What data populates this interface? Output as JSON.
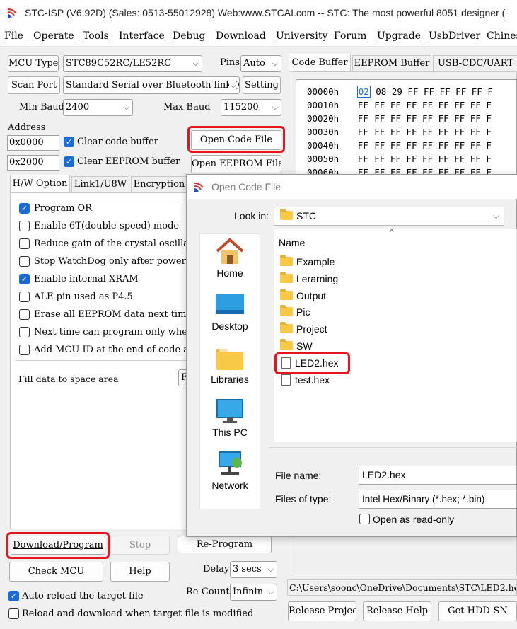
{
  "window": {
    "title": "STC-ISP (V6.92D) (Sales: 0513-55012928) Web:www.STCAI.com  -- STC: The most powerful 8051 designer (",
    "menu": [
      "File",
      "Operate",
      "Tools",
      "Interface",
      "Debug",
      "Download",
      "University",
      "Forum",
      "Upgrade",
      "UsbDriver",
      "Chines"
    ]
  },
  "mcu": {
    "type_label": "MCU Type",
    "type_value": "STC89C52RC/LE52RC",
    "pins_label": "Pins",
    "pins_value": "Auto",
    "scan_port_label": "Scan Port",
    "port_value": "Standard Serial over Bluetooth link (C",
    "setting_label": "Setting",
    "min_baud_label": "Min Baud",
    "min_baud_value": "2400",
    "max_baud_label": "Max Baud",
    "max_baud_value": "115200",
    "address_label": "Address",
    "address1": "0x0000",
    "address2": "0x2000",
    "clear_code_label": "Clear code buffer",
    "clear_eeprom_label": "Clear EEPROM buffer",
    "open_code_file": "Open Code File",
    "open_eeprom_file": "Open EEPROM File"
  },
  "hw_tabs": [
    "H/W Option",
    "Link1/U8W",
    "Encryption"
  ],
  "options": [
    {
      "label": "Program OR",
      "checked": true
    },
    {
      "label": "Enable 6T(double-speed) mode",
      "checked": false
    },
    {
      "label": "Reduce gain of the crystal oscillator",
      "checked": false
    },
    {
      "label": "Stop WatchDog only after power-do",
      "checked": false
    },
    {
      "label": "Enable internal XRAM",
      "checked": true
    },
    {
      "label": "ALE pin used as P4.5",
      "checked": false
    },
    {
      "label": "Erase all EEPROM data next time pr",
      "checked": false
    },
    {
      "label": "Next time can program only when P1",
      "checked": false
    },
    {
      "label": "Add MCU ID at the end of code area",
      "checked": false
    }
  ],
  "fill_label": "Fill data to space area",
  "fill_value": "F",
  "bottom": {
    "download_program": "Download/Program",
    "stop": "Stop",
    "re_program": "Re-Program",
    "check_mcu": "Check MCU",
    "help": "Help",
    "delay_label": "Delay",
    "delay_value": "3 secs",
    "recount_label": "Re-Count",
    "recount_value": "Infinin",
    "auto_reload": "Auto reload the target file",
    "reload_download": "Reload and download when target file is modified",
    "path": "C:\\Users\\soonc\\OneDrive\\Documents\\STC\\LED2.hex",
    "release_project": "Release Project",
    "release_help": "Release Help",
    "get_hdd_sn": "Get HDD-SN"
  },
  "right_tabs": [
    "Code Buffer",
    "EEPROM Buffer",
    "USB-CDC/UART I"
  ],
  "hex": [
    {
      "addr": "00000h",
      "first": "02",
      "rest": "08 29 FF FF FF FF FF F"
    },
    {
      "addr": "00010h",
      "first": "FF",
      "rest": "FF FF FF FF FF FF FF F"
    },
    {
      "addr": "00020h",
      "first": "FF",
      "rest": "FF FF FF FF FF FF FF F"
    },
    {
      "addr": "00030h",
      "first": "FF",
      "rest": "FF FF FF FF FF FF FF F"
    },
    {
      "addr": "00040h",
      "first": "FF",
      "rest": "FF FF FF FF FF FF FF F"
    },
    {
      "addr": "00050h",
      "first": "FF",
      "rest": "FF FF FF FF FF FF FF F"
    },
    {
      "addr": "00060h",
      "first": "FF",
      "rest": "FF FF FF FF FF FF FF F"
    }
  ],
  "dialog": {
    "title": "Open Code File",
    "look_in_label": "Look in:",
    "look_in_value": "STC",
    "name_header": "Name",
    "places": [
      "Home",
      "Desktop",
      "Libraries",
      "This PC",
      "Network"
    ],
    "folders": [
      "Example",
      "Lerarning",
      "Output",
      "Pic",
      "Project",
      "SW"
    ],
    "files": [
      "LED2.hex",
      "test.hex"
    ],
    "file_name_label": "File name:",
    "file_name_value": "LED2.hex",
    "files_of_type_label": "Files of type:",
    "files_of_type_value": "Intel Hex/Binary (*.hex; *.bin)",
    "read_only_label": "Open as read-only"
  }
}
